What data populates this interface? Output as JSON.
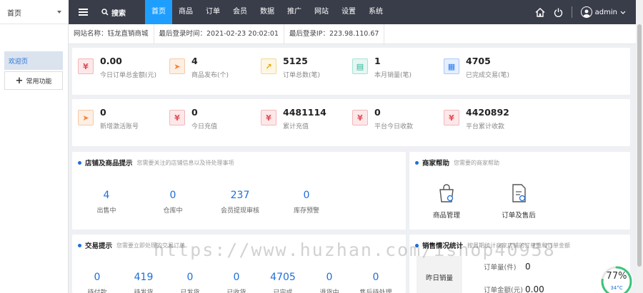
{
  "sidebar": {
    "select_value": "首页",
    "items": [
      "欢迎页",
      "常用功能"
    ]
  },
  "topbar": {
    "search_label": "搜索",
    "nav": [
      "首页",
      "商品",
      "订单",
      "会员",
      "数据",
      "推广",
      "网站",
      "设置",
      "系统"
    ],
    "user": "admin"
  },
  "info": {
    "site_name": "网站名称：钰龙直销商城",
    "last_login_time": "最后登录时间：2021-02-23 20:02:01",
    "last_login_ip": "最后登录IP：223.98.110.67"
  },
  "stats_row1": [
    {
      "value": "0.00",
      "label": "今日订单总金额(元)",
      "icon": "yen-icon",
      "color": "red"
    },
    {
      "value": "4",
      "label": "商品发布(个)",
      "icon": "plane-icon",
      "color": "orange"
    },
    {
      "value": "5125",
      "label": "订单总数(笔)",
      "icon": "chart-icon",
      "color": "yellow"
    },
    {
      "value": "1",
      "label": "本月销量(笔)",
      "icon": "clipboard-icon",
      "color": "green"
    },
    {
      "value": "4705",
      "label": "已完成交易(笔)",
      "icon": "document-icon",
      "color": "blue"
    }
  ],
  "stats_row2": [
    {
      "value": "0",
      "label": "新增激活账号",
      "icon": "plane-icon",
      "color": "orange"
    },
    {
      "value": "0",
      "label": "今日充值",
      "icon": "yen-icon",
      "color": "red"
    },
    {
      "value": "4481114",
      "label": "累计充值",
      "icon": "yen-icon",
      "color": "red"
    },
    {
      "value": "0",
      "label": "平台今日收款",
      "icon": "yen-icon",
      "color": "red"
    },
    {
      "value": "4420892",
      "label": "平台累计收款",
      "icon": "yen-icon",
      "color": "red"
    }
  ],
  "shop_panel": {
    "title": "店铺及商品提示",
    "subtitle": "您需要关注的店铺信息以及待处理事项",
    "items": [
      {
        "value": "4",
        "label": "出售中"
      },
      {
        "value": "0",
        "label": "仓库中"
      },
      {
        "value": "237",
        "label": "会员提现审核"
      },
      {
        "value": "0",
        "label": "库存预警"
      }
    ]
  },
  "help_panel": {
    "title": "商家帮助",
    "subtitle": "您需要的商家帮助",
    "items": [
      "商品管理",
      "订单及售后"
    ]
  },
  "trade_panel": {
    "title": "交易提示",
    "subtitle": "您需要立即处理的交易订单",
    "items": [
      {
        "value": "0",
        "label": "待付款"
      },
      {
        "value": "419",
        "label": "待发货"
      },
      {
        "value": "0",
        "label": "已发货"
      },
      {
        "value": "0",
        "label": "已收货"
      },
      {
        "value": "4705",
        "label": "已完成"
      },
      {
        "value": "0",
        "label": "退货中"
      },
      {
        "value": "0",
        "label": "售后待处理"
      }
    ]
  },
  "sales_panel": {
    "title": "销售情况统计",
    "subtitle": "按周期统计商家店铺的订单量和订单金额",
    "row_label": "昨日销量",
    "rows": [
      {
        "label": "订单量(件)",
        "value": "0"
      },
      {
        "label": "订单金额(元)",
        "value": "0.00"
      }
    ]
  },
  "watermark": "https://www.huzhan.com/ishop40958",
  "gauge": {
    "percent": "77%",
    "temp": "34°C",
    "fraction": 0.77
  }
}
